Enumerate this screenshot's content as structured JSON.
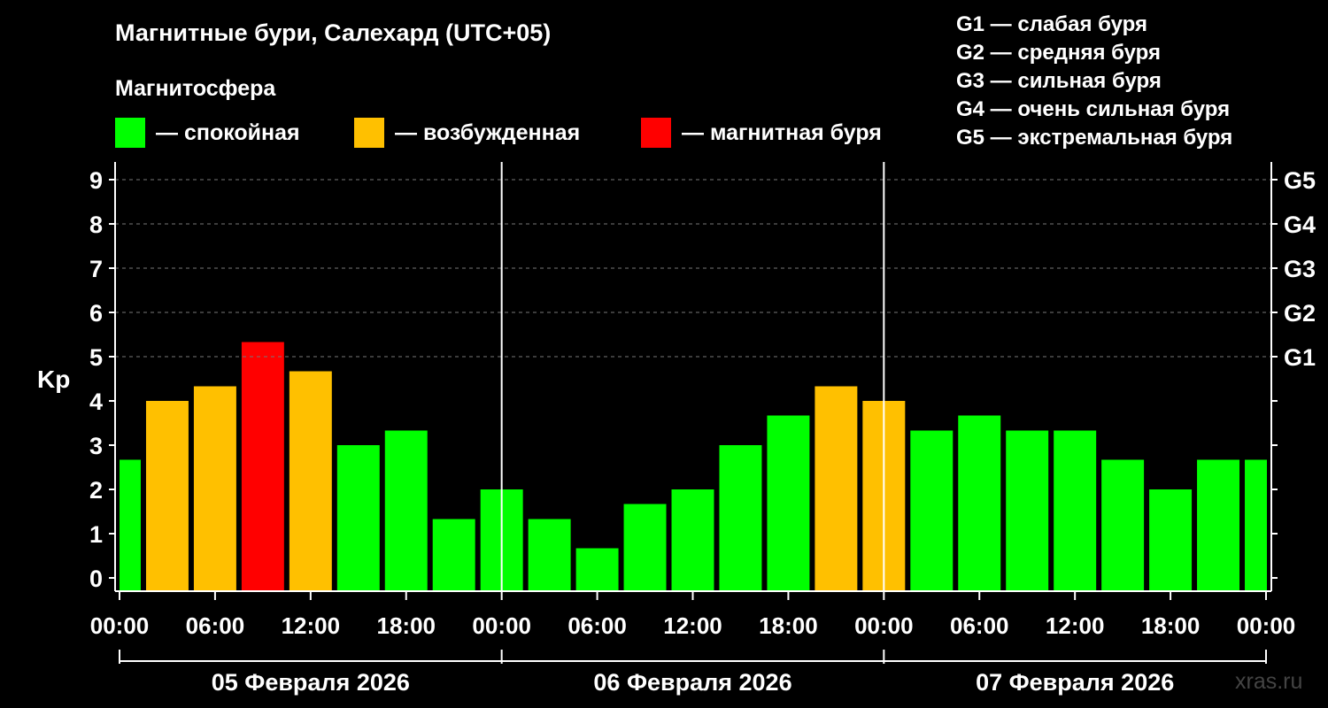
{
  "title": "Магнитные бури, Салехард (UTC+05)",
  "subtitle": "Магнитосфера",
  "legend": [
    {
      "label": "— спокойная",
      "color": "#00ff00"
    },
    {
      "label": "— возбужденная",
      "color": "#ffc000"
    },
    {
      "label": "— магнитная буря",
      "color": "#ff0000"
    }
  ],
  "g_scale": [
    "G1 — слабая буря",
    "G2 — средняя буря",
    "G3 — сильная буря",
    "G4 — очень сильная буря",
    "G5 — экстремальная буря"
  ],
  "watermark": "xras.ru",
  "chart_data": {
    "type": "bar",
    "ylabel": "Kp",
    "ylim": [
      -0.3,
      9.4
    ],
    "y_ticks": [
      0,
      1,
      2,
      3,
      4,
      5,
      6,
      7,
      8,
      9
    ],
    "g_ticks": [
      {
        "kp": 5,
        "label": "G1"
      },
      {
        "kp": 6,
        "label": "G2"
      },
      {
        "kp": 7,
        "label": "G3"
      },
      {
        "kp": 8,
        "label": "G4"
      },
      {
        "kp": 9,
        "label": "G5"
      }
    ],
    "x_tick_labels": [
      "00:00",
      "06:00",
      "12:00",
      "18:00",
      "00:00",
      "06:00",
      "12:00",
      "18:00",
      "00:00",
      "06:00",
      "12:00",
      "18:00",
      "00:00"
    ],
    "dates": [
      "05 Февраля 2026",
      "06 Февраля 2026",
      "07 Февраля 2026"
    ],
    "grid": true,
    "interval_hours": 3,
    "x_start_offset_hours": -1.5,
    "x_total_hours": 72,
    "values": [
      2.67,
      4.0,
      4.33,
      5.33,
      4.67,
      3.0,
      3.33,
      1.33,
      2.0,
      1.33,
      0.67,
      1.67,
      2.0,
      3.0,
      3.67,
      4.33,
      4.0,
      3.33,
      3.67,
      3.33,
      3.33,
      2.67,
      2.0,
      2.67,
      2.67
    ],
    "colors": {
      "quiet": "#00ff00",
      "active": "#ffc000",
      "storm": "#ff0000"
    }
  }
}
